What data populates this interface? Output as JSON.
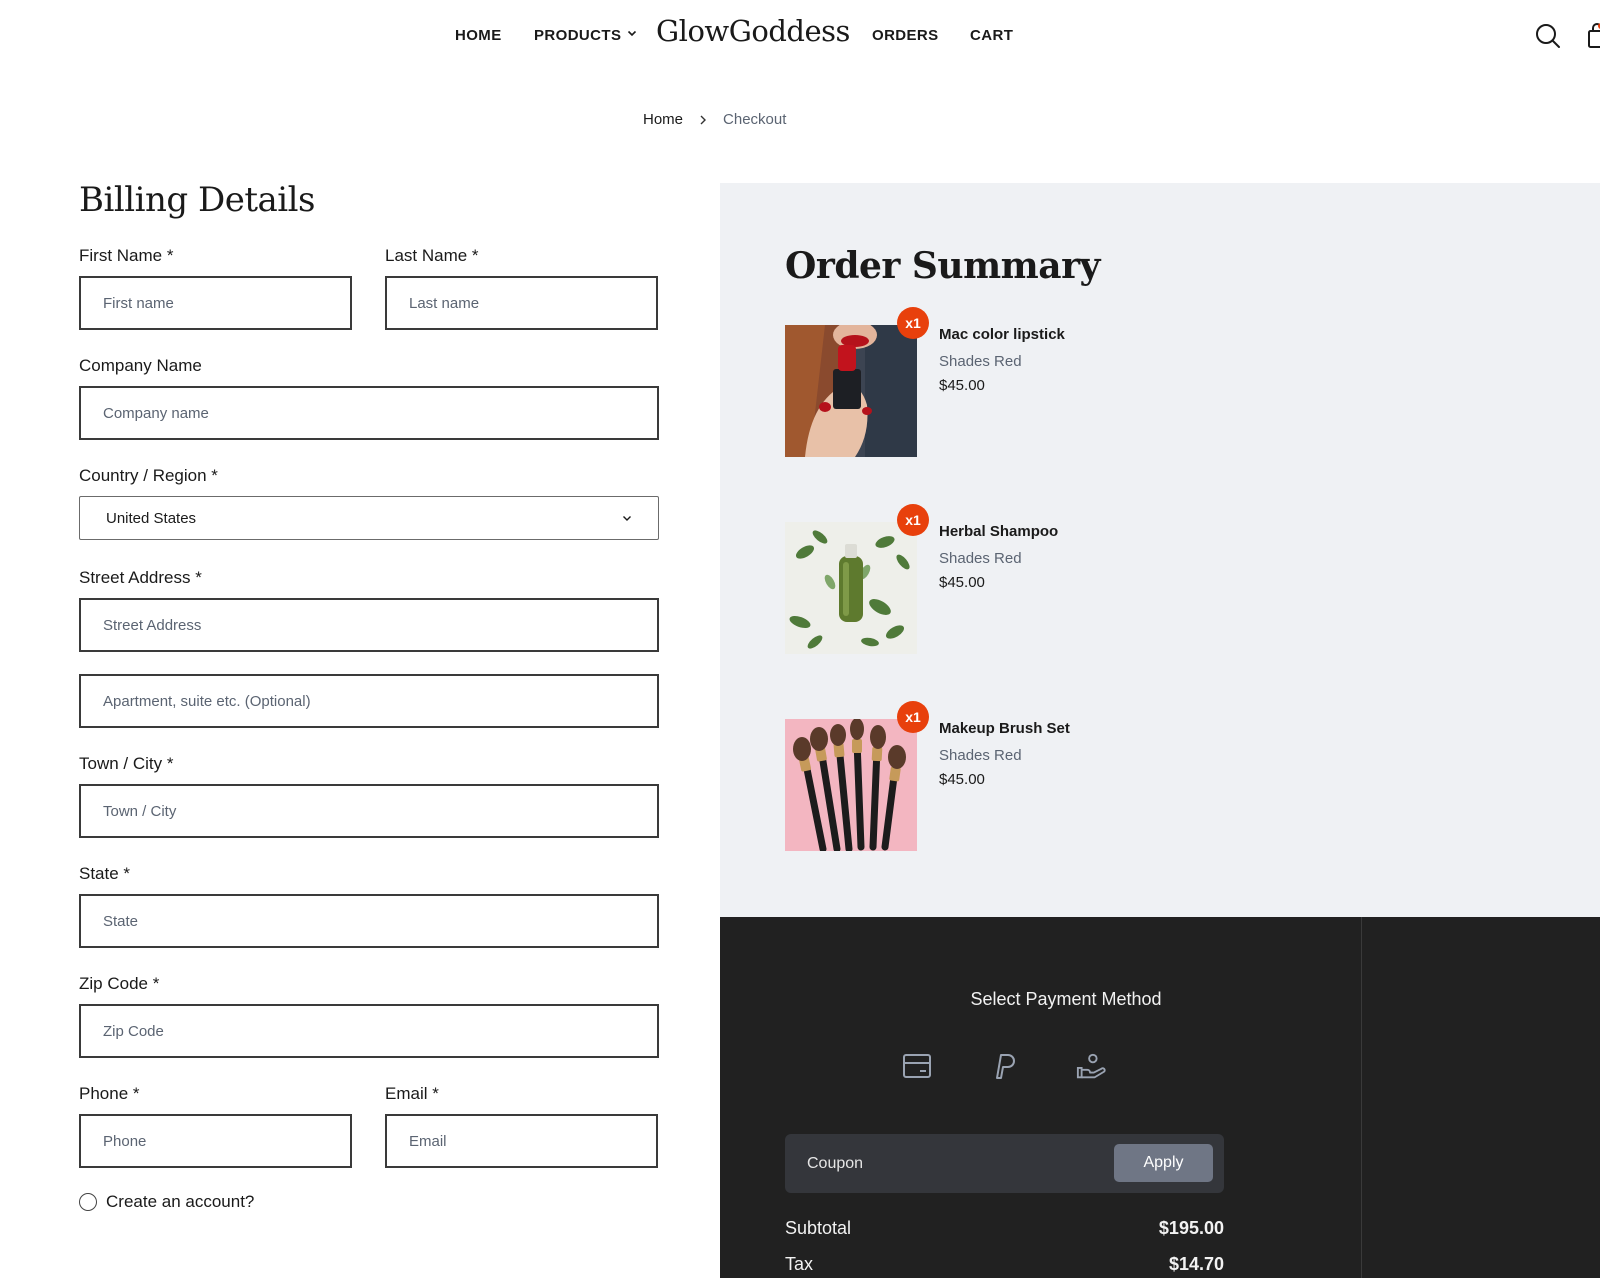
{
  "nav": {
    "home": "HOME",
    "products": "PRODUCTS",
    "brand": "GlowGoddess",
    "orders": "ORDERS",
    "cart": "CART"
  },
  "breadcrumb": {
    "home": "Home",
    "current": "Checkout"
  },
  "billing": {
    "title": "Billing Details",
    "first_name": {
      "label": "First Name *",
      "placeholder": "First name"
    },
    "last_name": {
      "label": "Last Name *",
      "placeholder": "Last name"
    },
    "company": {
      "label": "Company Name",
      "placeholder": "Company name"
    },
    "country": {
      "label": "Country / Region *",
      "value": "United States"
    },
    "street": {
      "label": "Street Address *",
      "placeholder": "Street Address",
      "placeholder2": "Apartment, suite etc. (Optional)"
    },
    "city": {
      "label": "Town / City *",
      "placeholder": "Town / City"
    },
    "state": {
      "label": "State *",
      "placeholder": "State"
    },
    "zip": {
      "label": "Zip Code *",
      "placeholder": "Zip Code"
    },
    "phone": {
      "label": "Phone *",
      "placeholder": "Phone"
    },
    "email": {
      "label": "Email *",
      "placeholder": "Email"
    },
    "create_account": "Create an account?"
  },
  "summary": {
    "title": "Order Summary",
    "items": [
      {
        "qty": "x1",
        "name": "Mac color lipstick",
        "variant": "Shades Red",
        "price": "$45.00",
        "image": "lipstick-photo"
      },
      {
        "qty": "x1",
        "name": "Herbal Shampoo",
        "variant": "Shades Red",
        "price": "$45.00",
        "image": "shampoo-photo"
      },
      {
        "qty": "x1",
        "name": "Makeup Brush Set",
        "variant": "Shades Red",
        "price": "$45.00",
        "image": "brush-set-photo"
      }
    ]
  },
  "payment": {
    "title": "Select Payment Method",
    "methods": [
      "card-icon",
      "paypal-icon",
      "cash-hand-icon"
    ],
    "coupon_placeholder": "Coupon",
    "apply": "Apply",
    "subtotal_label": "Subtotal",
    "subtotal_value": "$195.00",
    "tax_label": "Tax",
    "tax_value": "$14.70"
  },
  "colors": {
    "accent": "#e8400c",
    "summary_bg": "#eff1f4",
    "payment_bg": "#212121",
    "apply_btn": "#6f7685"
  }
}
